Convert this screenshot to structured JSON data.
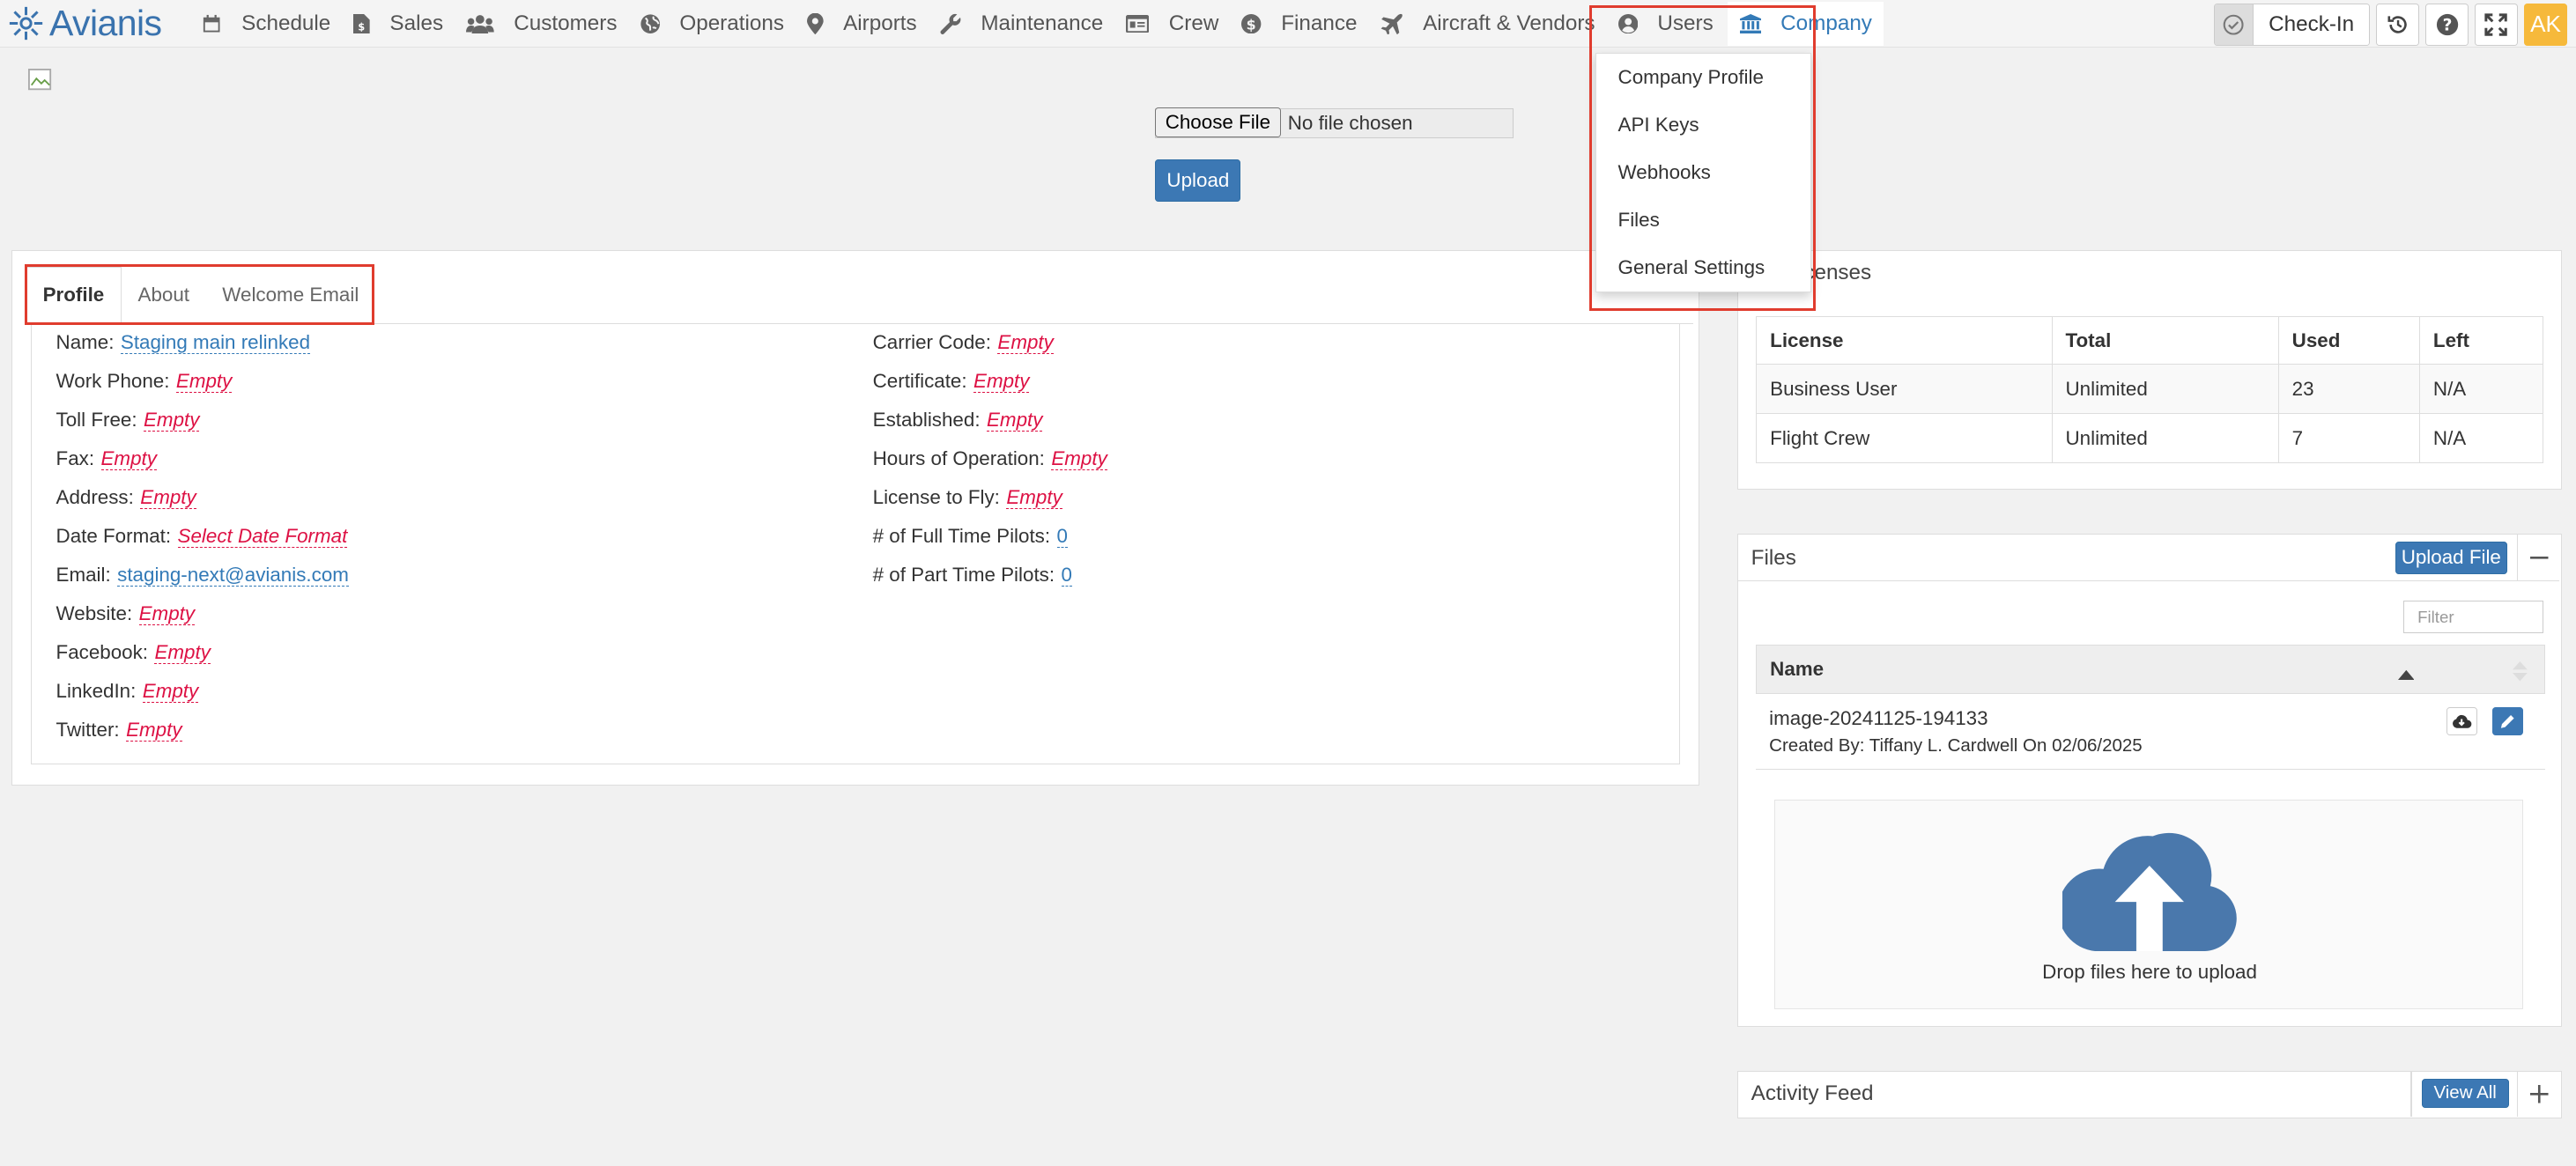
{
  "brand": {
    "name": "Avianis"
  },
  "nav": {
    "items": [
      {
        "label": "Schedule",
        "icon": "calendar-icon"
      },
      {
        "label": "Sales",
        "icon": "invoice-icon"
      },
      {
        "label": "Customers",
        "icon": "users-icon"
      },
      {
        "label": "Operations",
        "icon": "globe-icon"
      },
      {
        "label": "Airports",
        "icon": "map-pin-icon"
      },
      {
        "label": "Maintenance",
        "icon": "wrench-icon"
      },
      {
        "label": "Crew",
        "icon": "id-card-icon"
      },
      {
        "label": "Finance",
        "icon": "dollar-circle-icon"
      },
      {
        "label": "Aircraft & Vendors",
        "icon": "plane-icon"
      },
      {
        "label": "Users",
        "icon": "user-circle-icon"
      },
      {
        "label": "Company",
        "icon": "bank-icon"
      }
    ],
    "checkin_label": "Check-In",
    "avatar": "AK"
  },
  "company_menu": {
    "items": [
      "Company Profile",
      "API Keys",
      "Webhooks",
      "Files",
      "General Settings"
    ]
  },
  "upload": {
    "choose_label": "Choose File",
    "no_file": "No file chosen",
    "upload_label": "Upload"
  },
  "profile": {
    "tabs": [
      "Profile",
      "About",
      "Welcome Email"
    ],
    "left_fields": [
      {
        "label": "Name:",
        "value": "Staging main relinked"
      },
      {
        "label": "Work Phone:",
        "value": "Empty"
      },
      {
        "label": "Toll Free:",
        "value": "Empty"
      },
      {
        "label": "Fax:",
        "value": "Empty"
      },
      {
        "label": "Address:",
        "value": "Empty"
      },
      {
        "label": "Date Format:",
        "value": "Select Date Format"
      },
      {
        "label": "Email:",
        "value": "staging-next@avianis.com"
      },
      {
        "label": "Website:",
        "value": "Empty"
      },
      {
        "label": "Facebook:",
        "value": "Empty"
      },
      {
        "label": "LinkedIn:",
        "value": "Empty"
      },
      {
        "label": "Twitter:",
        "value": "Empty"
      }
    ],
    "right_fields": [
      {
        "label": "Carrier Code:",
        "value": "Empty"
      },
      {
        "label": "Certificate:",
        "value": "Empty"
      },
      {
        "label": "Established:",
        "value": "Empty"
      },
      {
        "label": "Hours of Operation:",
        "value": "Empty"
      },
      {
        "label": "License to Fly:",
        "value": "Empty"
      },
      {
        "label": "# of Full Time Pilots:",
        "value": "0"
      },
      {
        "label": "# of Part Time Pilots:",
        "value": "0"
      }
    ]
  },
  "licenses": {
    "title": "Licenses",
    "title_visible": "censes",
    "headers": [
      "License",
      "Total",
      "Used",
      "Left"
    ],
    "rows": [
      [
        "Business User",
        "Unlimited",
        "23",
        "N/A"
      ],
      [
        "Flight Crew",
        "Unlimited",
        "7",
        "N/A"
      ]
    ]
  },
  "files": {
    "title": "Files",
    "upload_label": "Upload File",
    "filter_placeholder": "Filter",
    "name_header": "Name",
    "rows": [
      {
        "name": "image-20241125-194133",
        "meta": "Created By: Tiffany L. Cardwell On 02/06/2025"
      }
    ],
    "drop_text": "Drop files here to upload"
  },
  "activity": {
    "title": "Activity Feed",
    "view_all_label": "View All"
  },
  "colors": {
    "accent": "#337ab7",
    "empty": "#dd1144",
    "highlight_box": "#e03c2e",
    "avatar": "#f6b93b"
  }
}
